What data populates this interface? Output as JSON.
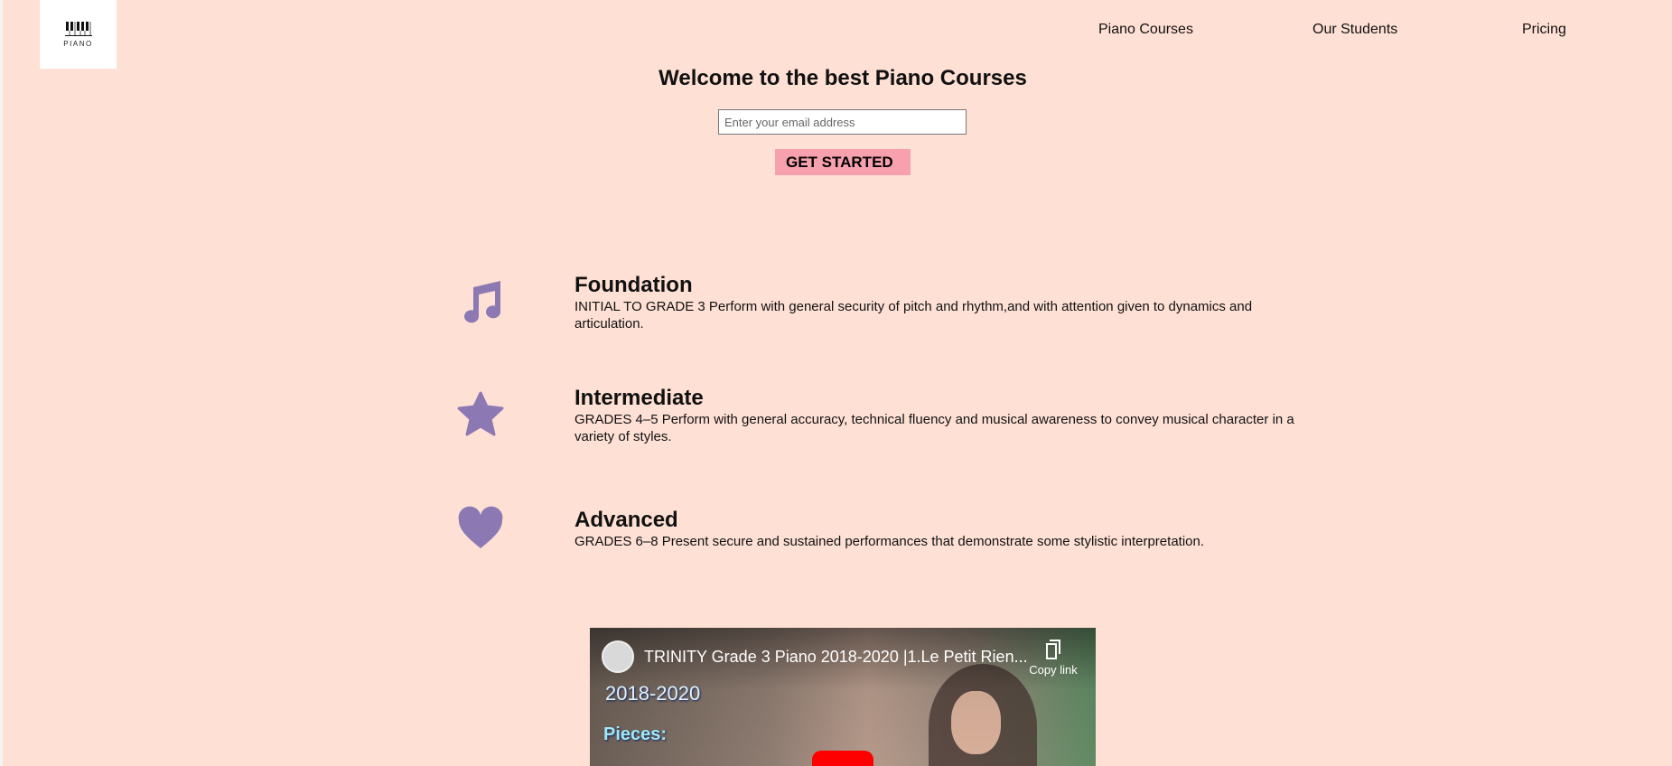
{
  "logo": {
    "text": "PIANO"
  },
  "nav": {
    "items": [
      "Piano Courses",
      "Our Students",
      "Pricing"
    ]
  },
  "hero": {
    "title": "Welcome to the best Piano Courses",
    "email_placeholder": "Enter your email address",
    "cta_label": "GET STARTED"
  },
  "features": [
    {
      "icon": "music-note-icon",
      "title": "Foundation",
      "description": "INITIAL TO GRADE 3 Perform with general security of pitch and rhythm,and with attention given to dynamics and articulation."
    },
    {
      "icon": "star-icon",
      "title": "Intermediate",
      "description": "GRADES 4–5 Perform with general accuracy, technical fluency and musical awareness to convey musical character in a variety of styles."
    },
    {
      "icon": "heart-icon",
      "title": "Advanced",
      "description": "GRADES 6–8 Present secure and sustained performances that demonstrate some stylistic interpretation."
    }
  ],
  "video": {
    "title": "TRINITY Grade 3 Piano 2018-2020 |1.Le Petit Rien...",
    "copy_link_label": "Copy link",
    "overlay_line1": "2018-2020",
    "overlay_line2": "Pieces:"
  },
  "colors": {
    "background": "#ffe0d5",
    "accent_button": "#f8a1ae",
    "icon": "#8c79b4"
  }
}
